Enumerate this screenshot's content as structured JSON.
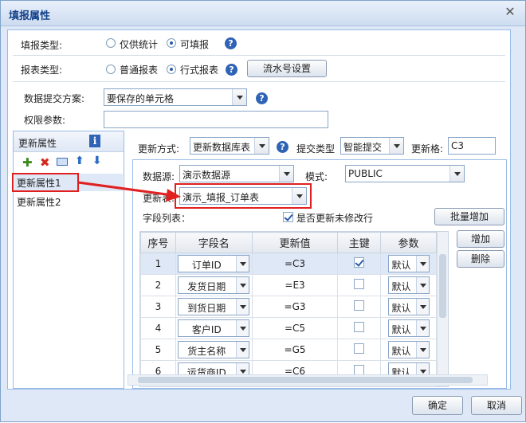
{
  "window": {
    "title": "填报属性"
  },
  "fill_type": {
    "label": "填报类型:",
    "options": [
      "仅供统计",
      "可填报"
    ],
    "selected": 1
  },
  "report_type": {
    "label": "报表类型:",
    "options": [
      "普通报表",
      "行式报表"
    ],
    "selected": 1,
    "serial_button": "流水号设置"
  },
  "submit_scheme": {
    "label": "数据提交方案:",
    "value": "要保存的单元格"
  },
  "permission": {
    "label": "权限参数:",
    "value": ""
  },
  "sidebar": {
    "title": "更新属性",
    "info_icon": "i",
    "items": [
      {
        "label": "更新属性1"
      },
      {
        "label": "更新属性2"
      }
    ]
  },
  "update": {
    "method_label": "更新方式:",
    "method_value": "更新数据库表",
    "submit_type_label": "提交类型",
    "submit_type_value": "智能提交",
    "cell_label": "更新格:",
    "cell_value": "C3"
  },
  "source": {
    "datasource_label": "数据源:",
    "datasource_value": "演示数据源",
    "mode_label": "模式:",
    "mode_value": "PUBLIC",
    "table_label": "更新表:",
    "table_value": "演示_填报_订单表"
  },
  "fields": {
    "label": "字段列表：",
    "update_unmodified_label": "是否更新未修改行",
    "batch_add": "批量增加",
    "add": "增加",
    "delete": "删除",
    "headers": [
      "序号",
      "字段名",
      "更新值",
      "主键",
      "参数"
    ],
    "rows": [
      {
        "no": "1",
        "field": "订单ID",
        "value": "=C3",
        "key": true,
        "param": "默认"
      },
      {
        "no": "2",
        "field": "发货日期",
        "value": "=E3",
        "key": false,
        "param": "默认"
      },
      {
        "no": "3",
        "field": "到货日期",
        "value": "=G3",
        "key": false,
        "param": "默认"
      },
      {
        "no": "4",
        "field": "客户ID",
        "value": "=C5",
        "key": false,
        "param": "默认"
      },
      {
        "no": "5",
        "field": "货主名称",
        "value": "=G5",
        "key": false,
        "param": "默认"
      },
      {
        "no": "6",
        "field": "运货商ID",
        "value": "=C6",
        "key": false,
        "param": "默认"
      }
    ]
  },
  "footer": {
    "ok": "确定",
    "cancel": "取消"
  },
  "colors": {
    "accent": "#15428b",
    "highlight": "#e02020",
    "selection": "#dfe8f6"
  }
}
